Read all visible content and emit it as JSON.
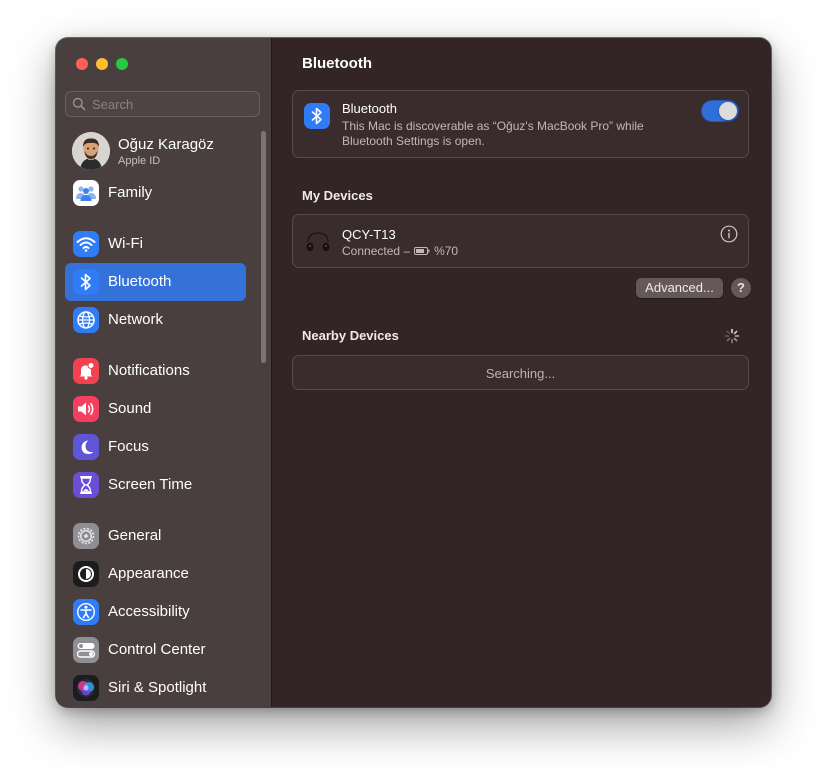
{
  "search": {
    "placeholder": "Search"
  },
  "user": {
    "name": "Oğuz Karagöz",
    "subtitle": "Apple ID"
  },
  "sidebar": {
    "items": [
      {
        "label": "Family",
        "icon": "family-icon",
        "color": "#ffffff"
      },
      {
        "label": "Wi-Fi",
        "icon": "wifi-icon",
        "color": "#2f7cf6"
      },
      {
        "label": "Bluetooth",
        "icon": "bluetooth-icon",
        "color": "#2f7cf6",
        "active": true
      },
      {
        "label": "Network",
        "icon": "globe-icon",
        "color": "#2f7cf6"
      },
      {
        "label": "Notifications",
        "icon": "bell-icon",
        "color": "#f2424f"
      },
      {
        "label": "Sound",
        "icon": "speaker-icon",
        "color": "#f43f5e"
      },
      {
        "label": "Focus",
        "icon": "moon-icon",
        "color": "#5e55d9"
      },
      {
        "label": "Screen Time",
        "icon": "hourglass-icon",
        "color": "#6a4fd6"
      },
      {
        "label": "General",
        "icon": "gear-icon",
        "color": "#8e8e93"
      },
      {
        "label": "Appearance",
        "icon": "appearance-icon",
        "color": "#1c1c1e"
      },
      {
        "label": "Accessibility",
        "icon": "accessibility-icon",
        "color": "#2f7cf6"
      },
      {
        "label": "Control Center",
        "icon": "toggles-icon",
        "color": "#8e8e93"
      },
      {
        "label": "Siri & Spotlight",
        "icon": "siri-icon",
        "color": "#1c1c1e"
      }
    ]
  },
  "main": {
    "title": "Bluetooth",
    "bluetooth": {
      "title": "Bluetooth",
      "description": "This Mac is discoverable as “Oğuz's MacBook Pro” while Bluetooth Settings is open.",
      "enabled": true
    },
    "my_devices_label": "My Devices",
    "device": {
      "name": "QCY-T13",
      "status_prefix": "Connected –",
      "battery": "%70"
    },
    "advanced_label": "Advanced...",
    "help_label": "?",
    "nearby_label": "Nearby Devices",
    "searching_label": "Searching..."
  },
  "colors": {
    "accent": "#3471d9",
    "window_bg": "#332425",
    "sidebar_bg": "#4a3f3f"
  }
}
